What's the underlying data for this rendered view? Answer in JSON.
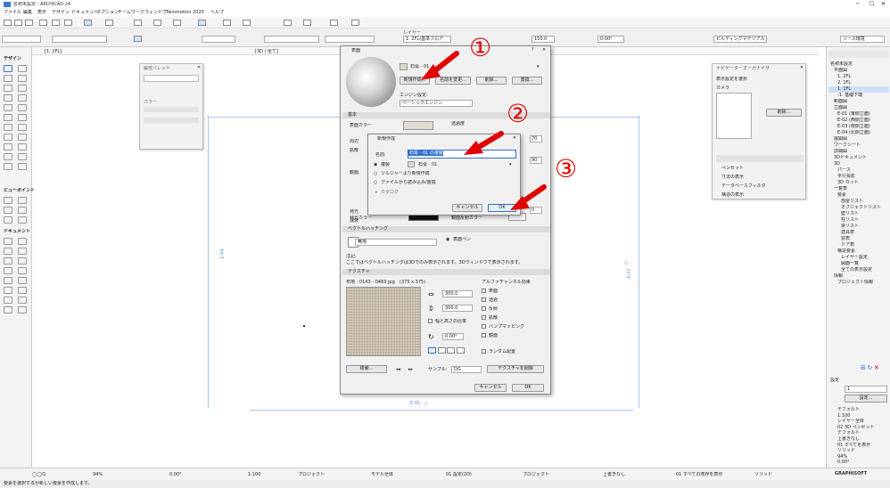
{
  "window": {
    "title": "名称未設定 - ARCHICAD 24",
    "menus": [
      "ファイル",
      "編集",
      "表示",
      "デザイン",
      "ドキュメント",
      "オプション",
      "チームワーク",
      "ウィンドウ",
      "Twinmotion 2020",
      "ヘルプ"
    ]
  },
  "infobox": {
    "layer_label": "レイヤー",
    "layer_value": "1. 2FL(基準フロア",
    "angle_value": "150.0",
    "angle_value2": "0.00°",
    "pen_value": "ビルディングマテリアル",
    "top_right_value": "ソース環境"
  },
  "tabs": {
    "plan_tab": "[1. 1FL]",
    "view_tab": "[3D / 全て]"
  },
  "left_palette": {
    "design_label": "デザイン",
    "view_label": "ビューポイント",
    "doc_label": "ドキュメント"
  },
  "property_panel": {
    "title": "属性パレット",
    "pen_label": "カラー"
  },
  "surface_dialog": {
    "title": "表面",
    "surface_name": "石膏 - 01",
    "new_button": "新規作成...",
    "rename_button": "名前を変更...",
    "delete_button": "削除...",
    "replace_button": "置換...",
    "engine_label": "エンジン設定:",
    "engine_value": "ベーシックエンジン",
    "section_basic": "基本",
    "color_label": "表面カラー",
    "ambient_label": "周辺",
    "diffuse_label": "拡散",
    "specular_label": "鏡面",
    "transparency_label": "透過度",
    "emission_label": "発光",
    "attenuation_label": "減衰",
    "emission_color_label": "発光カラー",
    "reflect_color_label": "鏡面反射カラー",
    "value_70": "70",
    "value_90": "90",
    "value_0": "0",
    "section_vector": "ベクトルハッチング",
    "vector_value": "無地",
    "pen_option": "表面ペン",
    "note_label": "注記:",
    "note_text": "ここではベクトルハッチングは3Dでのみ表示されます。3Dウィンドウで表示されます。",
    "section_texture": "テクスチャ",
    "texture_name": "布地 - 0143 - 0483.jpg",
    "texture_size": "(375 x 375)",
    "width_value": "300.0",
    "height_value": "300.0",
    "keep_ratio_label": "幅と高さの比率",
    "angle_value": "0.00°",
    "alpha_label": "アルファチャンネル効果",
    "alpha_opt1": "表面",
    "alpha_opt2": "透過",
    "alpha_opt3": "反射",
    "alpha_opt4": "拡散",
    "alpha_opt5": "バンプマッピング",
    "alpha_opt6": "鏡面",
    "random_label": "ランダム配置",
    "search_button": "検索...",
    "sample_label": "サンプル:",
    "sample_value": "DG",
    "remove_texture_button": "テクスチャを削除",
    "cancel_button": "キャンセル",
    "ok_button": "OK"
  },
  "new_dialog": {
    "title": "新規作成",
    "name_label": "名前:",
    "name_value": "石膏 - 01 の複製",
    "duplicate_label": "複製",
    "duplicate_value": "石膏 - 01",
    "opt_new": "ソルジャーより新規作成",
    "opt_import": "ファイルから読み込み/置換",
    "library_label": "カタログ",
    "cancel_button": "キャンセル",
    "ok_button": "OK"
  },
  "annotations": {
    "circle1": "①",
    "circle2": "②",
    "circle3": "③"
  },
  "right_float_panel": {
    "title": "ナビゲーターオーガナイザ",
    "tab_label": "表示設定を選択",
    "list_label": "カメラ",
    "button1": "削除...",
    "section1": "ペンセット",
    "section2": "寸法の表示",
    "section3": "データベースフィルタ",
    "section4": "構造の表示"
  },
  "navigator": {
    "items": [
      "名称未設定",
      "平面図",
      "1. 2FL",
      "2. 1FL",
      "1. 1FL",
      "-1. 基礎下端",
      "断面図",
      "立面図",
      "E-01 (東側立面)",
      "E-02 (西側立面)",
      "E-03 (南側立面)",
      "E-04 (北側立面)",
      "展開図",
      "ワークシート",
      "詳細図",
      "3Dドキュメント",
      "3D",
      "パース",
      "平行投影",
      "3D カット",
      "一覧表",
      "要素",
      "部屋リスト",
      "オブジェクトリスト",
      "壁リスト",
      "柱リスト",
      "梁リスト",
      "建具表",
      "窓表",
      "ドア表",
      "構造要素",
      "レイヤー設定",
      "図面一覧",
      "全ての表示設定",
      "情報",
      "プロジェクト情報"
    ]
  },
  "right_bottom": {
    "header": "設定",
    "field_value": "1",
    "button": "設定...",
    "props": [
      "デフォルト",
      "1:100",
      "レイヤー全体",
      "02 3D ペンセット",
      "デフォルト",
      "上書きなし",
      "01 すべてを表示",
      "ソリッド",
      "94%",
      "0.00°"
    ]
  },
  "statusbar": {
    "zoom": "94%",
    "angle": "0.00°",
    "scale": "1:100",
    "pen": "プロジェクト",
    "model": "モデル全体",
    "layer": "01 設定(2D)",
    "structure": "プロジェクト",
    "override": "上書きなし",
    "renovation": "01 すべての既存を表示",
    "view": "ソリッド",
    "logo": "GRAPHISOFT"
  },
  "bottom_hint": "要素を選択するか新しい要素を作成します。",
  "elevation_marks": {
    "left": "E-04",
    "right": "E-02",
    "bottom": "E-01"
  }
}
